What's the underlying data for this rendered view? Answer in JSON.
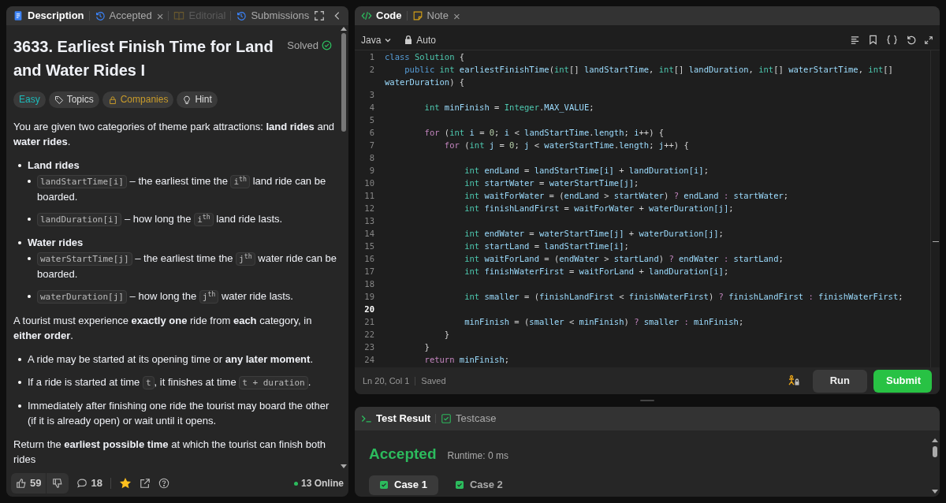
{
  "left_tabs": [
    {
      "kind": "description",
      "label": "Description",
      "selected": true,
      "disabled": false
    },
    {
      "kind": "accepted",
      "label": "Accepted",
      "selected": false,
      "disabled": false,
      "close": "×"
    },
    {
      "kind": "editorial",
      "label": "Editorial",
      "selected": false,
      "disabled": true
    },
    {
      "kind": "submissions",
      "label": "Submissions",
      "selected": false,
      "disabled": false
    }
  ],
  "problem": {
    "title": "3633. Earliest Finish Time for Land and Water Rides I",
    "status": "Solved",
    "solved": true,
    "tags": [
      {
        "kind": "difficulty",
        "label": "Easy"
      },
      {
        "kind": "topics",
        "label": "Topics"
      },
      {
        "kind": "companies",
        "label": "Companies"
      },
      {
        "kind": "hint",
        "label": "Hint"
      }
    ],
    "description": [
      {
        "kind": "paragraph",
        "parts": [
          {
            "kind": "text",
            "text": "You are given two categories of theme park attractions: **land rides** and **water rides**."
          }
        ]
      },
      {
        "kind": "list",
        "items": [
          {
            "parts": [
              {
                "kind": "text",
                "text": "**Land rides**"
              }
            ],
            "children": [
              {
                "parts": [
                  {
                    "kind": "code",
                    "text": "landStartTime[i]"
                  },
                  {
                    "kind": "text",
                    "text": " – the earliest time the "
                  },
                  {
                    "kind": "code",
                    "text": "i$^{th}$"
                  },
                  {
                    "kind": "text",
                    "text": " land ride can be boarded."
                  }
                ]
              },
              {
                "parts": [
                  {
                    "kind": "code",
                    "text": "landDuration[i]"
                  },
                  {
                    "kind": "text",
                    "text": " – how long the "
                  },
                  {
                    "kind": "code",
                    "text": "i$^{th}$"
                  },
                  {
                    "kind": "text",
                    "text": " land ride lasts."
                  }
                ]
              }
            ]
          },
          {
            "parts": [
              {
                "kind": "text",
                "text": "**Water rides**"
              }
            ],
            "children": [
              {
                "parts": [
                  {
                    "kind": "code",
                    "text": "waterStartTime[j]"
                  },
                  {
                    "kind": "text",
                    "text": " – the earliest time the "
                  },
                  {
                    "kind": "code",
                    "text": "j$^{th}$"
                  },
                  {
                    "kind": "text",
                    "text": " water ride can be boarded."
                  }
                ]
              },
              {
                "parts": [
                  {
                    "kind": "code",
                    "text": "waterDuration[j]"
                  },
                  {
                    "kind": "text",
                    "text": " – how long the "
                  },
                  {
                    "kind": "code",
                    "text": "j$^{th}$"
                  },
                  {
                    "kind": "text",
                    "text": " water ride lasts."
                  }
                ]
              }
            ]
          }
        ]
      },
      {
        "kind": "paragraph",
        "parts": [
          {
            "kind": "text",
            "text": "A tourist must experience **exactly one** ride from **each** category, in **either order**."
          }
        ]
      },
      {
        "kind": "list",
        "items": [
          {
            "parts": [
              {
                "kind": "text",
                "text": "A ride may be started at its opening time or **any later moment**."
              }
            ]
          },
          {
            "parts": [
              {
                "kind": "text",
                "text": "If a ride is started at time "
              },
              {
                "kind": "code",
                "text": "t"
              },
              {
                "kind": "text",
                "text": ", it finishes at time "
              },
              {
                "kind": "code",
                "text": "t + duration"
              },
              {
                "kind": "text",
                "text": "."
              }
            ]
          },
          {
            "parts": [
              {
                "kind": "text",
                "text": "Immediately after finishing one ride the tourist may board the other (if it is already open) or wait until it opens."
              }
            ]
          }
        ]
      },
      {
        "kind": "paragraph",
        "parts": [
          {
            "kind": "text",
            "text": "Return the **earliest possible time** at which the tourist can finish both rides"
          }
        ]
      }
    ]
  },
  "footer": {
    "likes": "59",
    "comments": "18",
    "starred": true,
    "online": "13 Online"
  },
  "editor_tabs": [
    {
      "kind": "code",
      "label": "Code",
      "selected": true
    },
    {
      "kind": "note",
      "label": "Note",
      "selected": false,
      "close": "×"
    }
  ],
  "editor_toolbar": {
    "language": "Java",
    "mode": "Auto"
  },
  "code_lines": [
    {
      "number": "1",
      "current": false,
      "tokens": [
        {
          "kind": "keyword",
          "text": "class "
        },
        {
          "kind": "type",
          "text": "Solution"
        },
        {
          "kind": "plain",
          "text": " {"
        }
      ]
    },
    {
      "number": "2",
      "current": false,
      "tokens": [
        {
          "kind": "keyword",
          "text": "    public "
        },
        {
          "kind": "type",
          "text": "int "
        },
        {
          "kind": "name",
          "text": "earliestFinishTime"
        },
        {
          "kind": "plain",
          "text": "("
        },
        {
          "kind": "type",
          "text": "int"
        },
        {
          "kind": "plain",
          "text": "[] "
        },
        {
          "kind": "name",
          "text": "landStartTime"
        },
        {
          "kind": "plain",
          "text": ", "
        },
        {
          "kind": "type",
          "text": "int"
        },
        {
          "kind": "plain",
          "text": "[] "
        },
        {
          "kind": "name",
          "text": "landDuration"
        },
        {
          "kind": "plain",
          "text": ", "
        },
        {
          "kind": "type",
          "text": "int"
        },
        {
          "kind": "plain",
          "text": "[] "
        },
        {
          "kind": "name",
          "text": "waterStartTime"
        },
        {
          "kind": "plain",
          "text": ", "
        },
        {
          "kind": "type",
          "text": "int"
        },
        {
          "kind": "plain",
          "text": "[]"
        }
      ]
    },
    {
      "tokens": [
        {
          "kind": "name",
          "text": "waterDuration"
        },
        {
          "kind": "plain",
          "text": ") {"
        }
      ]
    },
    {
      "number": "3",
      "current": false
    },
    {
      "number": "4",
      "current": false,
      "tokens": [
        {
          "kind": "type",
          "text": "        int "
        },
        {
          "kind": "name",
          "text": "minFinish"
        },
        {
          "kind": "plain",
          "text": " = "
        },
        {
          "kind": "type",
          "text": "Integer"
        },
        {
          "kind": "plain",
          "text": "."
        },
        {
          "kind": "name",
          "text": "MAX_VALUE"
        },
        {
          "kind": "plain",
          "text": ";"
        }
      ]
    },
    {
      "number": "5",
      "current": false
    },
    {
      "number": "6",
      "current": false,
      "tokens": [
        {
          "kind": "control",
          "text": "        for "
        },
        {
          "kind": "plain",
          "text": "("
        },
        {
          "kind": "type",
          "text": "int "
        },
        {
          "kind": "name",
          "text": "i"
        },
        {
          "kind": "plain",
          "text": " = "
        },
        {
          "kind": "number",
          "text": "0"
        },
        {
          "kind": "plain",
          "text": "; "
        },
        {
          "kind": "name",
          "text": "i"
        },
        {
          "kind": "plain",
          "text": " < "
        },
        {
          "kind": "name",
          "text": "landStartTime"
        },
        {
          "kind": "plain",
          "text": "."
        },
        {
          "kind": "name",
          "text": "length"
        },
        {
          "kind": "plain",
          "text": "; "
        },
        {
          "kind": "name",
          "text": "i"
        },
        {
          "kind": "plain",
          "text": "++) {"
        }
      ]
    },
    {
      "number": "7",
      "current": false,
      "tokens": [
        {
          "kind": "control",
          "text": "            for "
        },
        {
          "kind": "plain",
          "text": "("
        },
        {
          "kind": "type",
          "text": "int "
        },
        {
          "kind": "name",
          "text": "j"
        },
        {
          "kind": "plain",
          "text": " = "
        },
        {
          "kind": "number",
          "text": "0"
        },
        {
          "kind": "plain",
          "text": "; "
        },
        {
          "kind": "name",
          "text": "j"
        },
        {
          "kind": "plain",
          "text": " < "
        },
        {
          "kind": "name",
          "text": "waterStartTime"
        },
        {
          "kind": "plain",
          "text": "."
        },
        {
          "kind": "name",
          "text": "length"
        },
        {
          "kind": "plain",
          "text": "; "
        },
        {
          "kind": "name",
          "text": "j"
        },
        {
          "kind": "plain",
          "text": "++) {"
        }
      ]
    },
    {
      "number": "8",
      "current": false
    },
    {
      "number": "9",
      "current": false,
      "tokens": [
        {
          "kind": "type",
          "text": "                int "
        },
        {
          "kind": "name",
          "text": "endLand"
        },
        {
          "kind": "plain",
          "text": " = "
        },
        {
          "kind": "name",
          "text": "landStartTime[i]"
        },
        {
          "kind": "plain",
          "text": " + "
        },
        {
          "kind": "name",
          "text": "landDuration[i]"
        },
        {
          "kind": "plain",
          "text": ";"
        }
      ]
    },
    {
      "number": "10",
      "current": false,
      "tokens": [
        {
          "kind": "type",
          "text": "                int "
        },
        {
          "kind": "name",
          "text": "startWater"
        },
        {
          "kind": "plain",
          "text": " = "
        },
        {
          "kind": "name",
          "text": "waterStartTime[j]"
        },
        {
          "kind": "plain",
          "text": ";"
        }
      ]
    },
    {
      "number": "11",
      "current": false,
      "tokens": [
        {
          "kind": "type",
          "text": "                int "
        },
        {
          "kind": "name",
          "text": "waitForWater"
        },
        {
          "kind": "plain",
          "text": " = ("
        },
        {
          "kind": "name",
          "text": "endLand"
        },
        {
          "kind": "plain",
          "text": " > "
        },
        {
          "kind": "name",
          "text": "startWater"
        },
        {
          "kind": "plain",
          "text": ") "
        },
        {
          "kind": "control",
          "text": "? "
        },
        {
          "kind": "name",
          "text": "endLand "
        },
        {
          "kind": "control",
          "text": ": "
        },
        {
          "kind": "name",
          "text": "startWater"
        },
        {
          "kind": "plain",
          "text": ";"
        }
      ]
    },
    {
      "number": "12",
      "current": false,
      "tokens": [
        {
          "kind": "type",
          "text": "                int "
        },
        {
          "kind": "name",
          "text": "finishLandFirst"
        },
        {
          "kind": "plain",
          "text": " = "
        },
        {
          "kind": "name",
          "text": "waitForWater"
        },
        {
          "kind": "plain",
          "text": " + "
        },
        {
          "kind": "name",
          "text": "waterDuration[j]"
        },
        {
          "kind": "plain",
          "text": ";"
        }
      ]
    },
    {
      "number": "13",
      "current": false
    },
    {
      "number": "14",
      "current": false,
      "tokens": [
        {
          "kind": "type",
          "text": "                int "
        },
        {
          "kind": "name",
          "text": "endWater"
        },
        {
          "kind": "plain",
          "text": " = "
        },
        {
          "kind": "name",
          "text": "waterStartTime[j]"
        },
        {
          "kind": "plain",
          "text": " + "
        },
        {
          "kind": "name",
          "text": "waterDuration[j]"
        },
        {
          "kind": "plain",
          "text": ";"
        }
      ]
    },
    {
      "number": "15",
      "current": false,
      "tokens": [
        {
          "kind": "type",
          "text": "                int "
        },
        {
          "kind": "name",
          "text": "startLand"
        },
        {
          "kind": "plain",
          "text": " = "
        },
        {
          "kind": "name",
          "text": "landStartTime[i]"
        },
        {
          "kind": "plain",
          "text": ";"
        }
      ]
    },
    {
      "number": "16",
      "current": false,
      "tokens": [
        {
          "kind": "type",
          "text": "                int "
        },
        {
          "kind": "name",
          "text": "waitForLand"
        },
        {
          "kind": "plain",
          "text": " = ("
        },
        {
          "kind": "name",
          "text": "endWater"
        },
        {
          "kind": "plain",
          "text": " > "
        },
        {
          "kind": "name",
          "text": "startLand"
        },
        {
          "kind": "plain",
          "text": ") "
        },
        {
          "kind": "control",
          "text": "? "
        },
        {
          "kind": "name",
          "text": "endWater "
        },
        {
          "kind": "control",
          "text": ": "
        },
        {
          "kind": "name",
          "text": "startLand"
        },
        {
          "kind": "plain",
          "text": ";"
        }
      ]
    },
    {
      "number": "17",
      "current": false,
      "tokens": [
        {
          "kind": "type",
          "text": "                int "
        },
        {
          "kind": "name",
          "text": "finishWaterFirst"
        },
        {
          "kind": "plain",
          "text": " = "
        },
        {
          "kind": "name",
          "text": "waitForLand"
        },
        {
          "kind": "plain",
          "text": " + "
        },
        {
          "kind": "name",
          "text": "landDuration[i]"
        },
        {
          "kind": "plain",
          "text": ";"
        }
      ]
    },
    {
      "number": "18",
      "current": false
    },
    {
      "number": "19",
      "current": false,
      "tokens": [
        {
          "kind": "type",
          "text": "                int "
        },
        {
          "kind": "name",
          "text": "smaller"
        },
        {
          "kind": "plain",
          "text": " = ("
        },
        {
          "kind": "name",
          "text": "finishLandFirst"
        },
        {
          "kind": "plain",
          "text": " < "
        },
        {
          "kind": "name",
          "text": "finishWaterFirst"
        },
        {
          "kind": "plain",
          "text": ") "
        },
        {
          "kind": "control",
          "text": "? "
        },
        {
          "kind": "name",
          "text": "finishLandFirst "
        },
        {
          "kind": "control",
          "text": ": "
        },
        {
          "kind": "name",
          "text": "finishWaterFirst"
        },
        {
          "kind": "plain",
          "text": ";"
        }
      ]
    },
    {
      "number": "20",
      "current": true
    },
    {
      "number": "21",
      "current": false,
      "tokens": [
        {
          "kind": "name",
          "text": "                minFinish"
        },
        {
          "kind": "plain",
          "text": " = ("
        },
        {
          "kind": "name",
          "text": "smaller"
        },
        {
          "kind": "plain",
          "text": " < "
        },
        {
          "kind": "name",
          "text": "minFinish"
        },
        {
          "kind": "plain",
          "text": ") "
        },
        {
          "kind": "control",
          "text": "? "
        },
        {
          "kind": "name",
          "text": "smaller "
        },
        {
          "kind": "control",
          "text": ": "
        },
        {
          "kind": "name",
          "text": "minFinish"
        },
        {
          "kind": "plain",
          "text": ";"
        }
      ]
    },
    {
      "number": "22",
      "current": false,
      "tokens": [
        {
          "kind": "plain",
          "text": "            }"
        }
      ]
    },
    {
      "number": "23",
      "current": false,
      "tokens": [
        {
          "kind": "plain",
          "text": "        }"
        }
      ]
    },
    {
      "number": "24",
      "current": false,
      "tokens": [
        {
          "kind": "control",
          "text": "        return "
        },
        {
          "kind": "name",
          "text": "minFinish"
        },
        {
          "kind": "plain",
          "text": ";"
        }
      ]
    }
  ],
  "editor_status": {
    "position": "Ln 20, Col 1",
    "saved": "Saved",
    "run": "Run",
    "submit": "Submit"
  },
  "result_tabs": [
    {
      "kind": "result",
      "label": "Test Result",
      "selected": true
    },
    {
      "kind": "testcase",
      "label": "Testcase",
      "selected": false
    }
  ],
  "result": {
    "verdict": "Accepted",
    "runtime": "Runtime: 0 ms",
    "cases": [
      {
        "label": "Case 1",
        "passed": true,
        "selected": true
      },
      {
        "label": "Case 2",
        "passed": true,
        "selected": false
      }
    ]
  }
}
